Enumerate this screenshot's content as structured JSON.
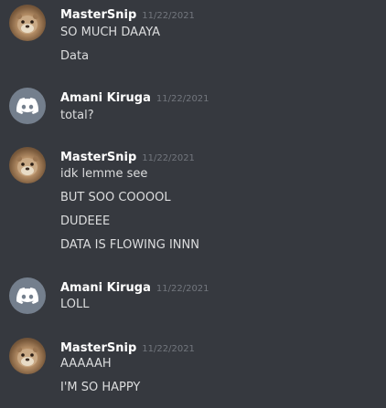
{
  "messages": [
    {
      "author": "MasterSnip",
      "timestamp": "11/22/2021",
      "avatar": "otter-avatar",
      "lines": [
        "SO MUCH DAAYA",
        "Data"
      ]
    },
    {
      "author": "Amani Kiruga",
      "timestamp": "11/22/2021",
      "avatar": "discord-default-avatar",
      "lines": [
        "total?"
      ]
    },
    {
      "author": "MasterSnip",
      "timestamp": "11/22/2021",
      "avatar": "otter-avatar",
      "lines": [
        "idk lemme see",
        "BUT SOO COOOOL",
        "DUDEEE",
        "DATA IS FLOWING INNN"
      ]
    },
    {
      "author": "Amani Kiruga",
      "timestamp": "11/22/2021",
      "avatar": "discord-default-avatar",
      "lines": [
        "LOLL"
      ]
    },
    {
      "author": "MasterSnip",
      "timestamp": "11/22/2021",
      "avatar": "otter-avatar",
      "lines": [
        "AAAAAH",
        "I'M SO HAPPY"
      ]
    }
  ],
  "colors": {
    "background": "#36393f",
    "username": "#ffffff",
    "timestamp": "#72767d",
    "message_text": "#dcddde",
    "default_avatar": "#747f8d"
  }
}
